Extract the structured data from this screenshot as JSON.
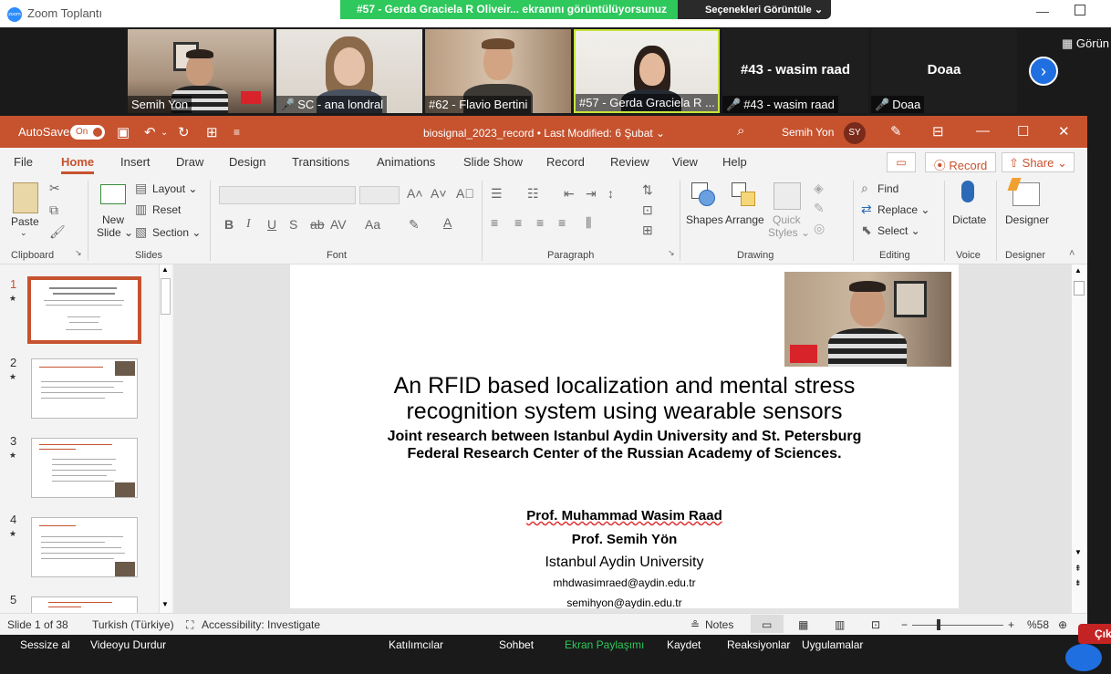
{
  "zoom": {
    "app_title": "Zoom Toplantı",
    "logo_text": "zoom",
    "share_banner": "#57 - Gerda Graciela R Oliveir... ekranını görüntülüyorsunuz",
    "view_options": "Seçenekleri Görüntüle ⌄",
    "minimize": "—",
    "gorunum": "Görün",
    "next_arrow": "›",
    "participants": [
      {
        "name": "Semih Yon",
        "muted": false
      },
      {
        "name": "SC - ana londral",
        "muted": true
      },
      {
        "name": "#62 - Flavio Bertini",
        "muted": false
      },
      {
        "name": "#57 - Gerda Graciela R ...",
        "muted": false
      },
      {
        "name": "#43 - wasim raad",
        "muted": true,
        "big": "#43 - wasim raad"
      },
      {
        "name": "Doaa",
        "muted": true,
        "big": "Doaa"
      }
    ],
    "toolbar": {
      "mute": "Sessize al",
      "video": "Videoyu Durdur",
      "participants": "Katılımcılar",
      "chat": "Sohbet",
      "share": "Ekran Paylaşımı",
      "record": "Kaydet",
      "reactions": "Reaksiyonlar",
      "apps": "Uygulamalar",
      "leave": "Çık"
    }
  },
  "ppt": {
    "autosave": "AutoSave",
    "autosave_state": "On",
    "doc_title": "biosignal_2023_record  •  Last Modified: 6 Şubat ⌄",
    "user": "Semih Yon",
    "user_initials": "SY",
    "menu": [
      "File",
      "Home",
      "Insert",
      "Draw",
      "Design",
      "Transitions",
      "Animations",
      "Slide Show",
      "Record",
      "Review",
      "View",
      "Help"
    ],
    "record_btn": "⦿ Record",
    "share_btn": "⇧ Share ⌄",
    "ribbon": {
      "paste": "Paste",
      "new_slide_1": "New",
      "new_slide_2": "Slide ⌄",
      "layout": "Layout ⌄",
      "reset": "Reset",
      "section": "Section ⌄",
      "shapes": "Shapes",
      "arrange": "Arrange",
      "quick_1": "Quick",
      "quick_2": "Styles ⌄",
      "find": "Find",
      "replace": "Replace ⌄",
      "select": "Select ⌄",
      "dictate": "Dictate",
      "designer": "Designer",
      "groups": [
        "Clipboard",
        "Slides",
        "Font",
        "Paragraph",
        "Drawing",
        "Editing",
        "Voice",
        "Designer"
      ]
    },
    "slide": {
      "title_1": "An RFID based localization and mental stress",
      "title_2": "recognition system using wearable sensors",
      "joint_1": "Joint  research  between Istanbul Aydin University and St. Petersburg",
      "joint_2": "Federal Research Center of the Russian Academy of Sciences.",
      "prof_1": "Prof. Muhammad Wasim Raad",
      "prof_2": "Prof. Semih Yön",
      "university": "Istanbul Aydin University",
      "email_1": "mhdwasimraed@aydin.edu.tr",
      "email_2": "semihyon@aydin.edu.tr"
    },
    "thumbnails": [
      "1",
      "2",
      "3",
      "4",
      "5"
    ],
    "status": {
      "slide_count": "Slide 1 of 38",
      "language": "Turkish (Türkiye)",
      "accessibility": "Accessibility: Investigate",
      "notes": "Notes",
      "zoom": "%58"
    }
  }
}
